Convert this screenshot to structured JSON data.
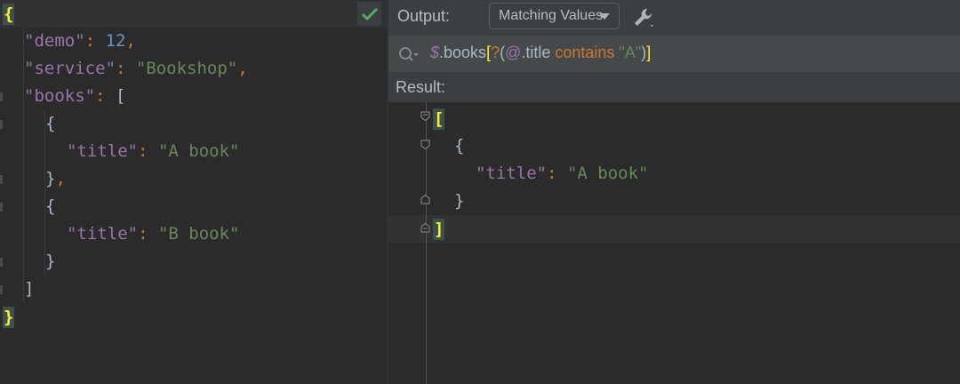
{
  "editor": {
    "check_icon": "checkmark-icon",
    "lines": [
      {
        "indent": 0,
        "tokens": [
          {
            "t": "{",
            "c": "hl"
          }
        ]
      },
      {
        "indent": 1,
        "tokens": [
          {
            "t": "\"demo\"",
            "c": "k"
          },
          {
            "t": ": ",
            "c": "p"
          },
          {
            "t": "12",
            "c": "n"
          },
          {
            "t": ",",
            "c": "p"
          }
        ]
      },
      {
        "indent": 1,
        "tokens": [
          {
            "t": "\"service\"",
            "c": "k"
          },
          {
            "t": ": ",
            "c": "p"
          },
          {
            "t": "\"Bookshop\"",
            "c": "s"
          },
          {
            "t": ",",
            "c": "p"
          }
        ]
      },
      {
        "indent": 1,
        "tokens": [
          {
            "t": "\"books\"",
            "c": "k"
          },
          {
            "t": ": ",
            "c": "p"
          },
          {
            "t": "[",
            "c": "br"
          }
        ]
      },
      {
        "indent": 2,
        "tokens": [
          {
            "t": "{",
            "c": "br"
          }
        ]
      },
      {
        "indent": 3,
        "tokens": [
          {
            "t": "\"title\"",
            "c": "k"
          },
          {
            "t": ": ",
            "c": "p"
          },
          {
            "t": "\"A book\"",
            "c": "s"
          }
        ]
      },
      {
        "indent": 2,
        "tokens": [
          {
            "t": "}",
            "c": "br"
          },
          {
            "t": ",",
            "c": "p"
          }
        ]
      },
      {
        "indent": 2,
        "tokens": [
          {
            "t": "{",
            "c": "br"
          }
        ]
      },
      {
        "indent": 3,
        "tokens": [
          {
            "t": "\"title\"",
            "c": "k"
          },
          {
            "t": ": ",
            "c": "p"
          },
          {
            "t": "\"B book\"",
            "c": "s"
          }
        ]
      },
      {
        "indent": 2,
        "tokens": [
          {
            "t": "}",
            "c": "br"
          }
        ]
      },
      {
        "indent": 1,
        "tokens": [
          {
            "t": "]",
            "c": "br"
          }
        ]
      },
      {
        "indent": 0,
        "tokens": [
          {
            "t": "}",
            "c": "hl"
          }
        ]
      }
    ]
  },
  "toolbar": {
    "output_label": "Output:",
    "mode_value": "Matching Values",
    "settings_icon": "wrench-icon"
  },
  "query": {
    "search_icon": "search-icon",
    "tokens": [
      {
        "t": "$",
        "c": "q-d"
      },
      {
        "t": ".books",
        "c": "q-w"
      },
      {
        "t": "[",
        "c": "q-b"
      },
      {
        "t": "?",
        "c": "q-o"
      },
      {
        "t": "(",
        "c": "q-w"
      },
      {
        "t": "@",
        "c": "q-at"
      },
      {
        "t": ".title ",
        "c": "q-w"
      },
      {
        "t": "contains ",
        "c": "q-o"
      },
      {
        "t": "\"A\"",
        "c": "q-s"
      },
      {
        "t": ")",
        "c": "q-w"
      },
      {
        "t": "]",
        "c": "q-b"
      }
    ]
  },
  "result": {
    "header": "Result:",
    "lines": [
      {
        "indent": 0,
        "tokens": [
          {
            "t": "[",
            "c": "hl"
          }
        ]
      },
      {
        "indent": 1,
        "tokens": [
          {
            "t": "{",
            "c": "br"
          }
        ]
      },
      {
        "indent": 2,
        "tokens": [
          {
            "t": "\"title\"",
            "c": "k"
          },
          {
            "t": ": ",
            "c": "p"
          },
          {
            "t": "\"A book\"",
            "c": "s"
          }
        ]
      },
      {
        "indent": 1,
        "tokens": [
          {
            "t": "}",
            "c": "br"
          }
        ]
      },
      {
        "indent": 0,
        "tokens": [
          {
            "t": "]",
            "c": "hl"
          }
        ]
      }
    ]
  },
  "colors": {
    "key": "#9876aa",
    "string": "#6a8759",
    "number": "#6897bb",
    "punct": "#cc7832",
    "bracket_highlight": "#ffef28",
    "check": "#59a869"
  }
}
